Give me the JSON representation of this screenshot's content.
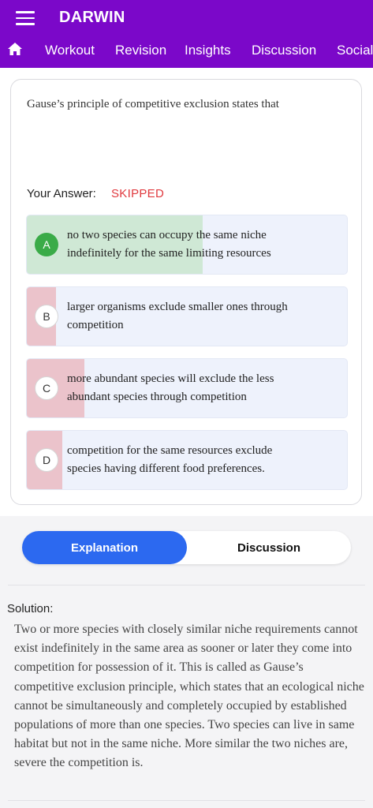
{
  "header": {
    "app_title": "DARWIN",
    "menu_icon": "hamburger-menu-icon",
    "home_icon": "home-icon",
    "nav_items": [
      "Workout",
      "Revision",
      "Insights",
      "Discussion",
      "Social"
    ],
    "brand_color": "#7b08c9"
  },
  "question": {
    "text": "Gause’s principle of competitive exclusion states that",
    "your_answer_label": "Your Answer:",
    "your_answer_value": "SKIPPED",
    "options": [
      {
        "letter": "A",
        "text": "no two species can occupy the same niche indefinitely for the same limiting resources",
        "correct": true,
        "percent": 55
      },
      {
        "letter": "B",
        "text": "larger organisms exclude smaller ones through competition",
        "correct": false,
        "percent": 9
      },
      {
        "letter": "C",
        "text": "more abundant species will exclude the less abundant species through competition",
        "correct": false,
        "percent": 18
      },
      {
        "letter": "D",
        "text": "competition for the same resources exclude species having different food preferences.",
        "correct": false,
        "percent": 11
      }
    ]
  },
  "tabs": {
    "explanation": "Explanation",
    "discussion": "Discussion",
    "active": "Explanation"
  },
  "solution": {
    "label": "Solution:",
    "text": "Two or more species with closely similar niche requirements cannot exist indefinitely in the same area as sooner or later they come into competition for possession of it. This is called as Gause’s competitive exclusion principle, which states that an ecological niche cannot be simultaneously and completely occupied by established populations of more than one species. Two species can live in same habitat but not in the same niche. More similar the two niches are, severe the competition is."
  },
  "colors": {
    "correct_fill": "#cfe8d5",
    "wrong_fill": "#ebc3cb",
    "correct_badge": "#3aab48",
    "skipped_text": "#e0393e",
    "active_tab": "#2c69f0"
  }
}
